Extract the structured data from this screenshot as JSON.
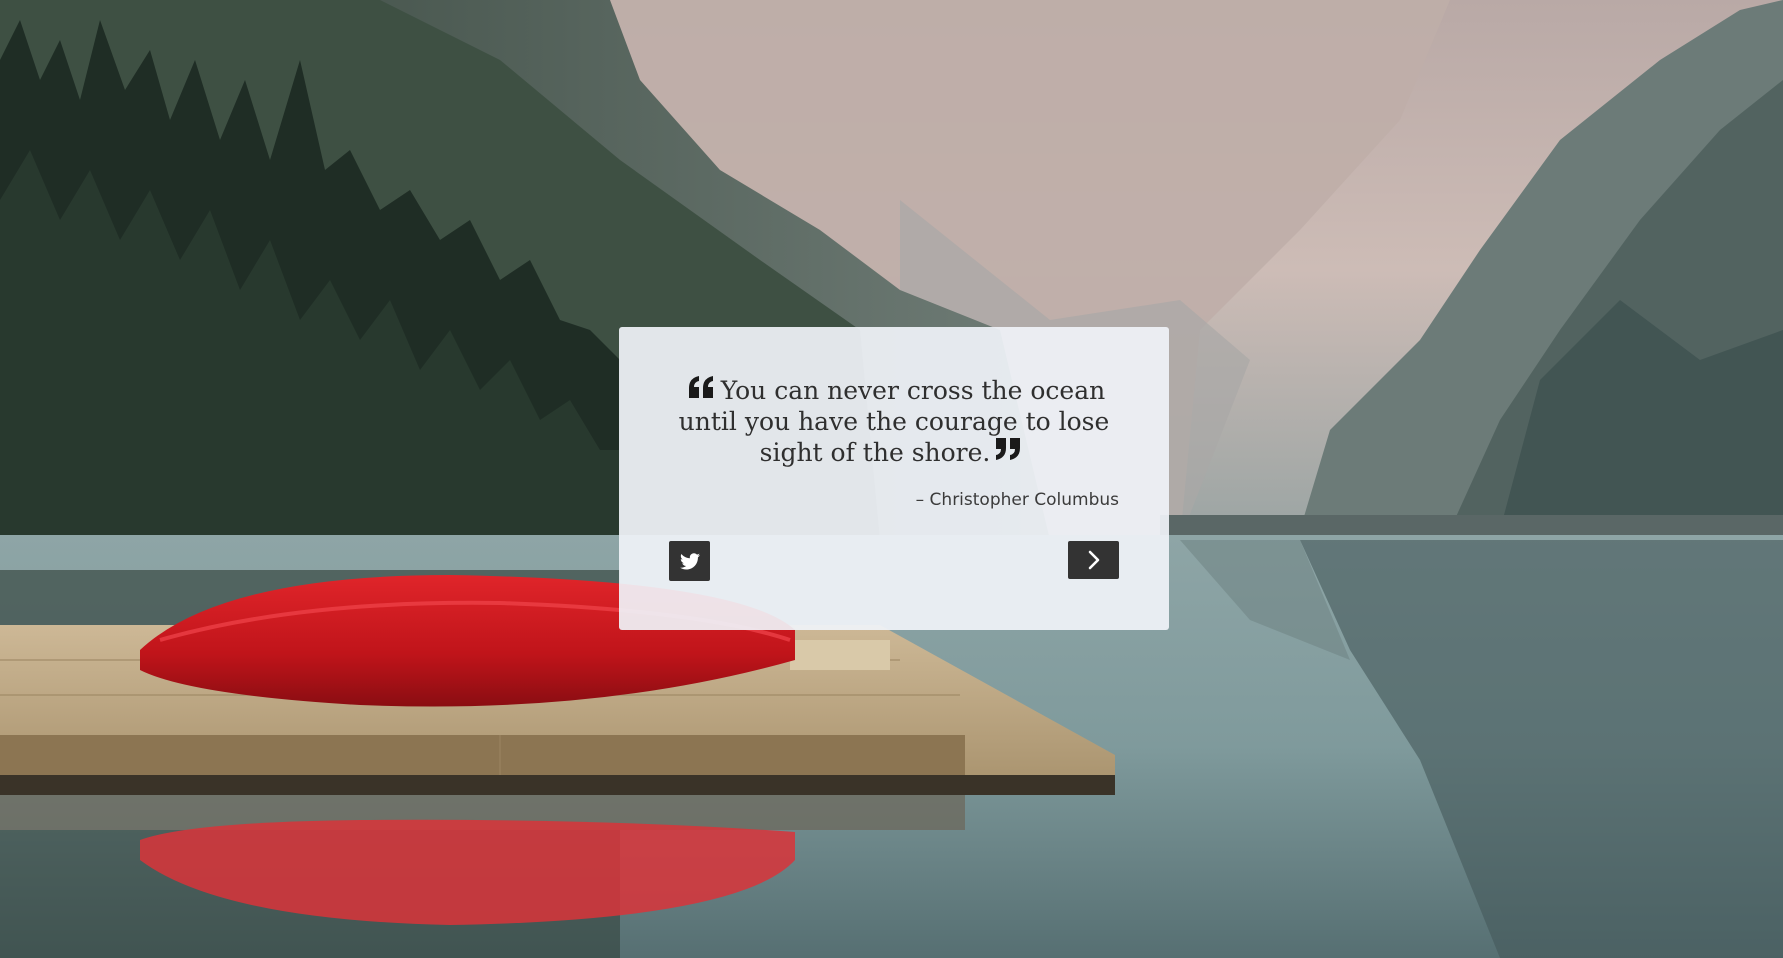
{
  "background": {
    "description_icon": "lake-mountain-canoe-photo",
    "colors": {
      "sky": "#c9b6b0",
      "forest": "#2c3d33",
      "water": "#7d9a99",
      "canoe": "#c8141b",
      "dock": "#c9b08a"
    }
  },
  "quote": {
    "open_icon": "quote-open-icon",
    "text": "You can never cross the ocean until you have the courage to lose sight of the shore.",
    "close_icon": "quote-close-icon",
    "author": "– Christopher Columbus"
  },
  "actions": {
    "tweet_icon": "twitter-icon",
    "next_icon": "chevron-right-icon"
  },
  "theme": {
    "button_bg": "#333333",
    "box_bg": "#f0f3f9",
    "text_color": "#2f2f2f"
  }
}
